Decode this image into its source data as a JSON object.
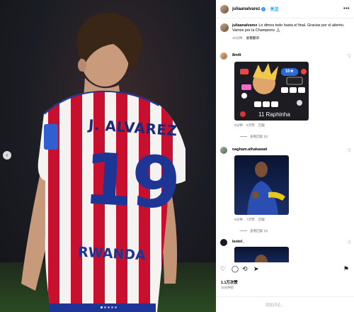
{
  "post": {
    "username": "juliaanalvarez",
    "follow_label": "关注",
    "jersey": {
      "name": "J. ALVAREZ",
      "number": "19",
      "sponsor": "RWANDA"
    }
  },
  "caption": {
    "username": "juliaanalvarez",
    "text": "Lo dimos todo hasta el final. Gracias por el aliento. Vamos por la Champions 🙏🏼",
    "time": "10分钟",
    "translate": "查看翻译"
  },
  "comments": [
    {
      "username": "8m4t",
      "time": "6分钟",
      "likes": "6次赞",
      "reply": "回复",
      "replies": "查看回复 (5)",
      "sticker": {
        "badge": "10★",
        "caption": "11 Raphinha"
      }
    },
    {
      "username": "nagham.alhakawati",
      "time": "6分钟",
      "likes": "7次赞",
      "reply": "回复",
      "replies": "查看回复 (3)"
    },
    {
      "username": "leotel_"
    }
  ],
  "engagement": {
    "likes": "1.1万次赞",
    "time": "10分钟前"
  },
  "add_comment": {
    "placeholder": "添加评论..."
  },
  "icons": [
    "chevron-left-icon",
    "more-icon",
    "heart-icon",
    "comment-icon",
    "share-icon",
    "send-icon",
    "bookmark-icon"
  ],
  "colors": {
    "accent": "#0095f6",
    "verified": "#3897f0",
    "jersey_blue": "#1e3596",
    "jersey_red": "#c8102e"
  }
}
